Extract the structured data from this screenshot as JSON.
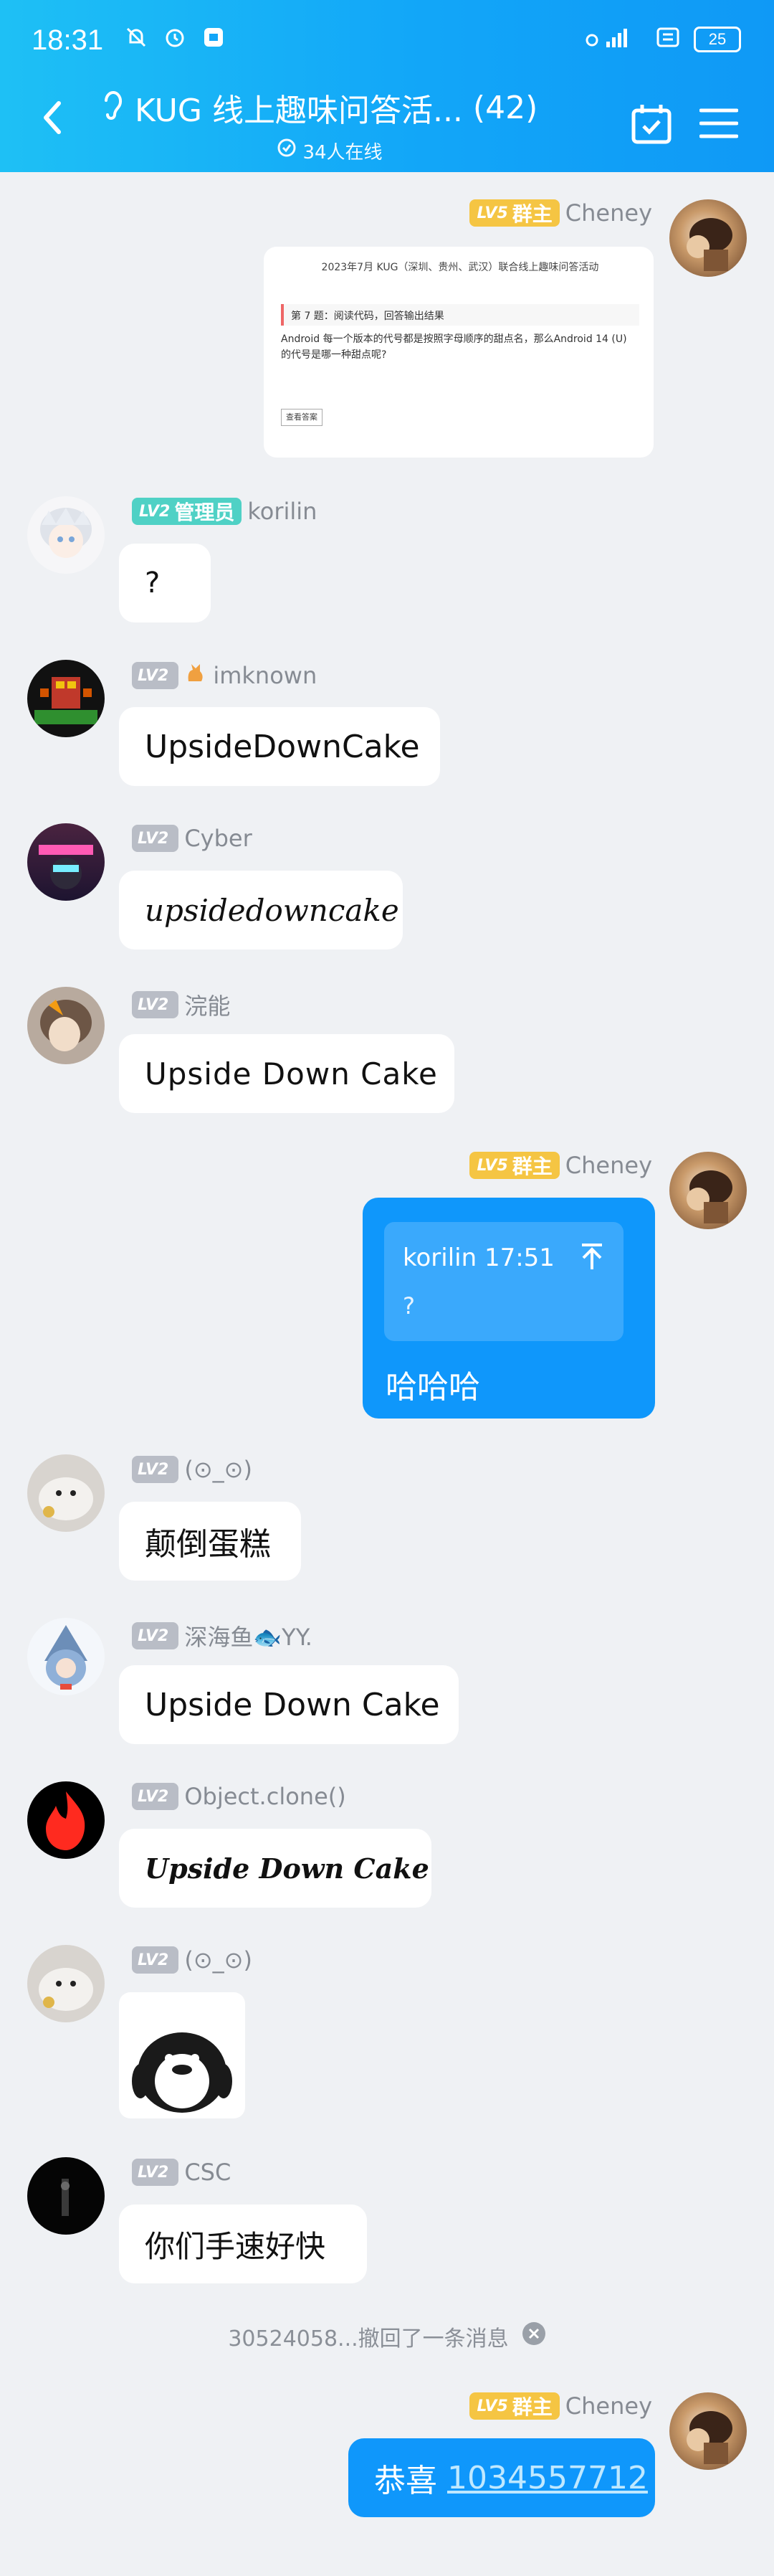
{
  "status_bar": {
    "time": "18:31",
    "battery": "25"
  },
  "header": {
    "title": "KUG 线上趣味问答活...",
    "member_count": "(42)",
    "online": "34人在线"
  },
  "badges": {
    "owner": "群主",
    "admin": "管理员",
    "lv5": "LV5",
    "lv2": "LV2"
  },
  "messages": [
    {
      "sender": "Cheney",
      "image_card": {
        "title": "2023年7月 KUG（深圳、贵州、武汉）联合线上趣味问答活动",
        "question_title": "第 7 题：阅读代码，回答输出结果",
        "question_body": "Android 每一个版本的代号都是按照字母顺序的甜点名，那么Android 14 (U) 的代号是哪一种甜点呢?",
        "button": "查看答案"
      }
    },
    {
      "sender": "korilin",
      "text": "?"
    },
    {
      "sender": "imknown",
      "text": "UpsideDownCake"
    },
    {
      "sender": "Cyber",
      "text": "upsidedowncake"
    },
    {
      "sender": "浣能",
      "text": "Upside Down Cake"
    },
    {
      "sender": "Cheney",
      "quote_author": "korilin 17:51",
      "quote_text": "?",
      "text": "哈哈哈"
    },
    {
      "sender": "(⊙_⊙)",
      "text": "颠倒蛋糕"
    },
    {
      "sender": "深海鱼🐟YY.",
      "text": "Upside Down Cake"
    },
    {
      "sender": "Object.clone()",
      "text": "Upside Down Cake"
    },
    {
      "sender": "(⊙_⊙)"
    },
    {
      "sender": "CSC",
      "text": "你们手速好快"
    },
    {
      "sender": "Cheney",
      "text_prefix": "恭喜 ",
      "mention_link": "1034557712"
    }
  ],
  "recall_notice": "30524058...撤回了一条消息",
  "colors": {
    "header": "#12a6f8",
    "bubble_self": "#0f97fb",
    "owner_badge": "#f5c543",
    "admin_badge": "#4fd1c5"
  }
}
